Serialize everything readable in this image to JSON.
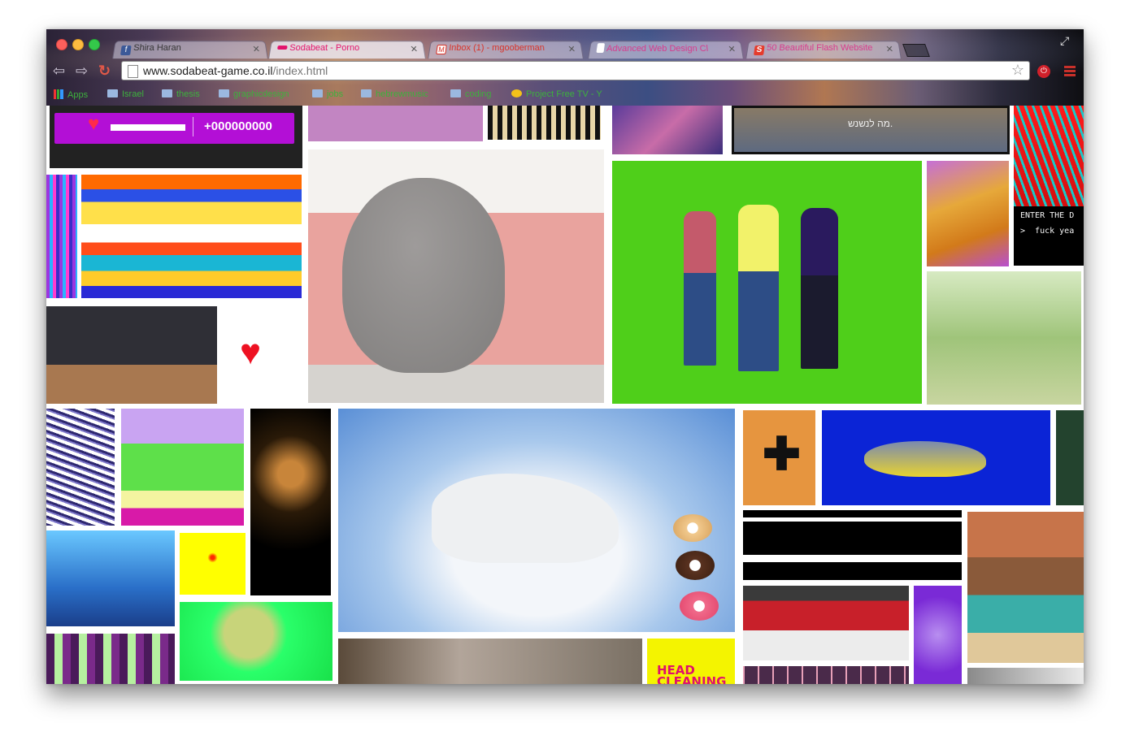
{
  "tabs": [
    {
      "label": "Shira Haran",
      "icon": "facebook-icon",
      "color": "#3b5998"
    },
    {
      "label": "Sodabeat - Porno",
      "icon": "sodabeat-icon",
      "color": "#e3126b",
      "active": true
    },
    {
      "label": "Inbox (1) - mgooberman",
      "icon": "gmail-icon",
      "color": "#d93025"
    },
    {
      "label": "Advanced Web Design Cl",
      "icon": "document-icon",
      "color": "#ffffff"
    },
    {
      "label": "50 Beautiful Flash Website",
      "icon": "smashing-icon",
      "color": "#e53b2c"
    }
  ],
  "url": {
    "host": "www.sodabeat-game.co.il",
    "path": "/index.html"
  },
  "bookmarks": [
    {
      "label": "Apps",
      "type": "apps"
    },
    {
      "label": "Israel",
      "type": "folder"
    },
    {
      "label": "thesis",
      "type": "folder"
    },
    {
      "label": "graphicdesign",
      "type": "folder"
    },
    {
      "label": "jobs",
      "type": "folder"
    },
    {
      "label": "hebrewmusic",
      "type": "folder"
    },
    {
      "label": "coding",
      "type": "folder"
    },
    {
      "label": "Project Free TV - Y",
      "type": "link"
    }
  ],
  "game": {
    "score": "+000000000",
    "health_fraction": 0.7
  },
  "texts": {
    "hebrew_caption": "מה לנשנש.",
    "enter_line": "ENTER THE D",
    "prompt_line": ">  fuck yea",
    "head_cleaning": "HEAD CLEANING"
  },
  "colors": {
    "accent": "#b30fd6",
    "heart": "#ee1122",
    "greenscreen": "#4fcf1a",
    "shark_bg": "#0b24d6",
    "plus_bg": "#e6953f"
  }
}
